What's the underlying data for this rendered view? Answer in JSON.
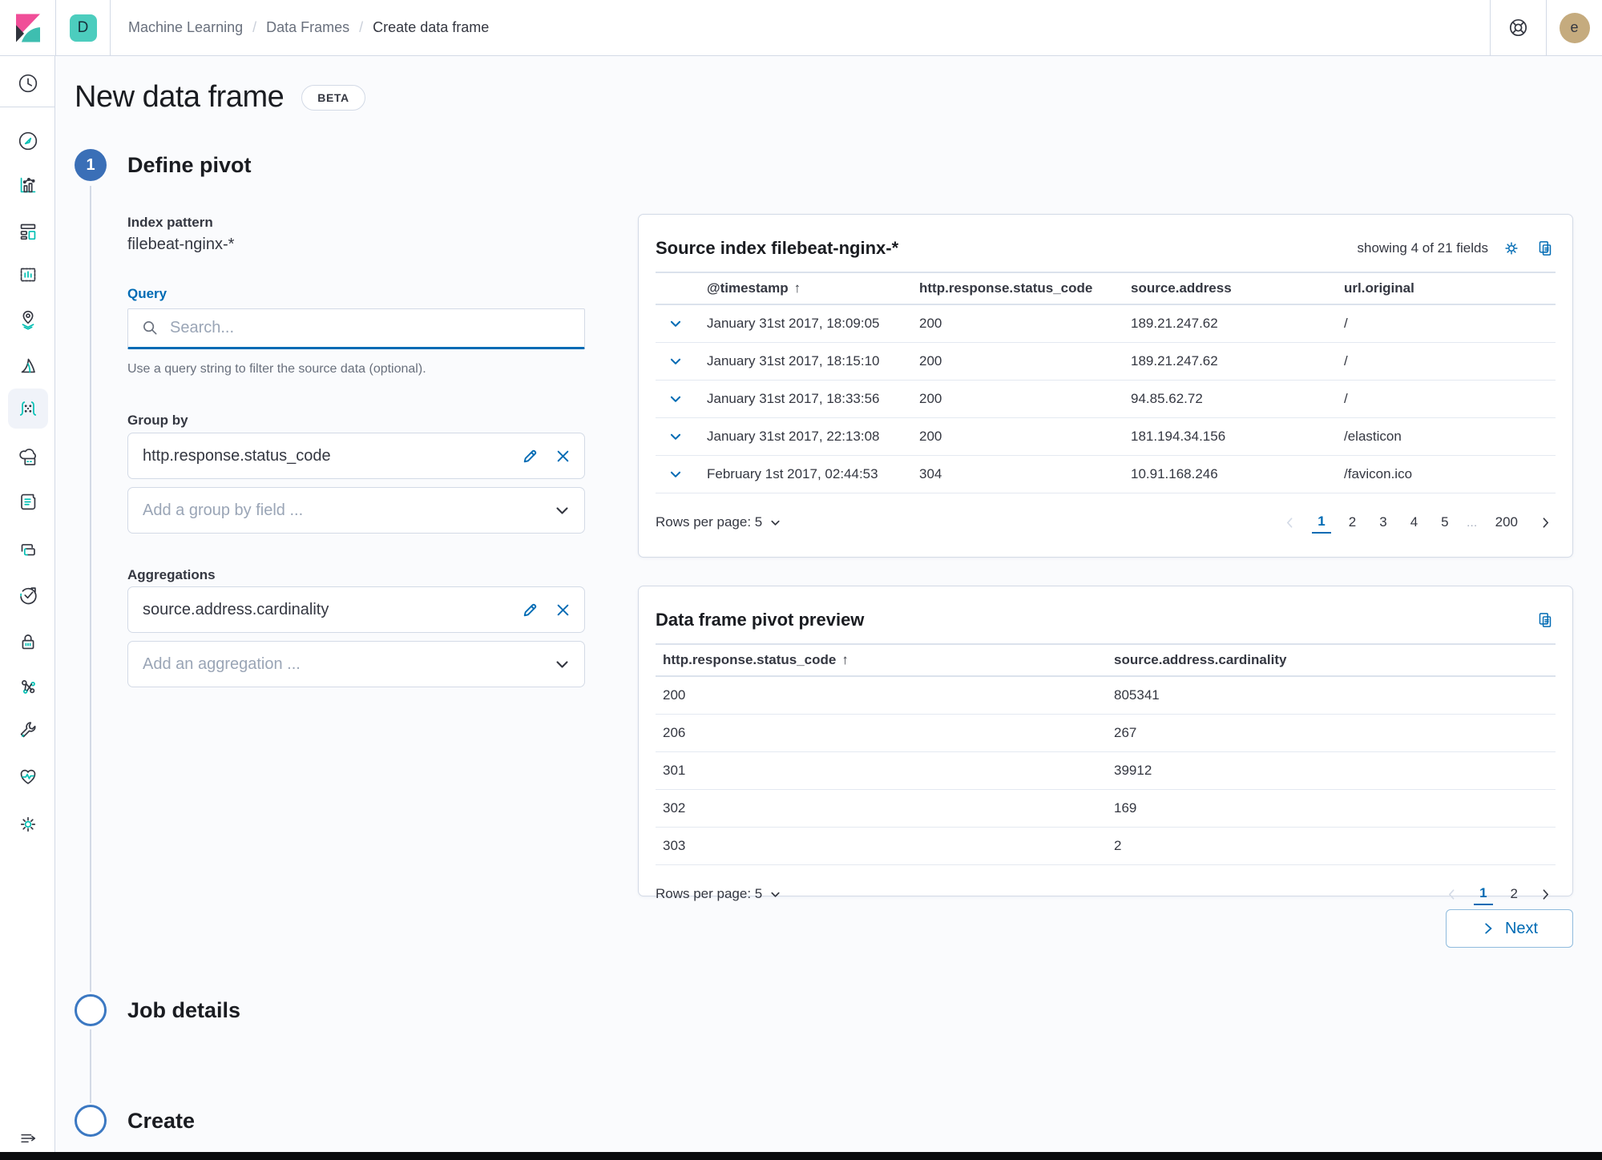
{
  "colors": {
    "primary": "#006BB4",
    "teal": "#00BFB3",
    "pink": "#F04E98",
    "text": "#343741",
    "subdued": "#69707D",
    "border": "#D3DAE6"
  },
  "topbar": {
    "space_initial": "D",
    "separator": "/",
    "breadcrumbs": [
      "Machine Learning",
      "Data Frames",
      "Create data frame"
    ],
    "avatar_initial": "e"
  },
  "page": {
    "title": "New data frame",
    "beta": "BETA"
  },
  "steps": {
    "step1_number": "1",
    "step1_label": "Define pivot",
    "step2_label": "Job details",
    "step3_label": "Create"
  },
  "form": {
    "index_pattern_label": "Index pattern",
    "index_pattern_value": "filebeat-nginx-*",
    "query_label": "Query",
    "query_placeholder": "Search...",
    "query_help": "Use a query string to filter the source data (optional).",
    "group_by_label": "Group by",
    "group_by_value": "http.response.status_code",
    "group_by_placeholder": "Add a group by field ...",
    "aggregations_label": "Aggregations",
    "aggregation_value": "source.address.cardinality",
    "aggregation_placeholder": "Add an aggregation ..."
  },
  "source_index": {
    "title": "Source index filebeat-nginx-*",
    "fields_summary": "showing 4 of 21 fields",
    "columns": [
      "@timestamp",
      "http.response.status_code",
      "source.address",
      "url.original"
    ],
    "rows": [
      [
        "January 31st 2017, 18:09:05",
        "200",
        "189.21.247.62",
        "/"
      ],
      [
        "January 31st 2017, 18:15:10",
        "200",
        "189.21.247.62",
        "/"
      ],
      [
        "January 31st 2017, 18:33:56",
        "200",
        "94.85.62.72",
        "/"
      ],
      [
        "January 31st 2017, 22:13:08",
        "200",
        "181.194.34.156",
        "/elasticon"
      ],
      [
        "February 1st 2017, 02:44:53",
        "304",
        "10.91.168.246",
        "/favicon.ico"
      ]
    ],
    "rows_per_page": "Rows per page: 5",
    "pages": [
      "1",
      "2",
      "3",
      "4",
      "5",
      "…",
      "200"
    ]
  },
  "pivot_preview": {
    "title": "Data frame pivot preview",
    "columns": [
      "http.response.status_code",
      "source.address.cardinality"
    ],
    "rows": [
      [
        "200",
        "805341"
      ],
      [
        "206",
        "267"
      ],
      [
        "301",
        "39912"
      ],
      [
        "302",
        "169"
      ],
      [
        "303",
        "2"
      ]
    ],
    "rows_per_page": "Rows per page: 5",
    "pages": [
      "1",
      "2"
    ]
  },
  "next_button": "Next"
}
